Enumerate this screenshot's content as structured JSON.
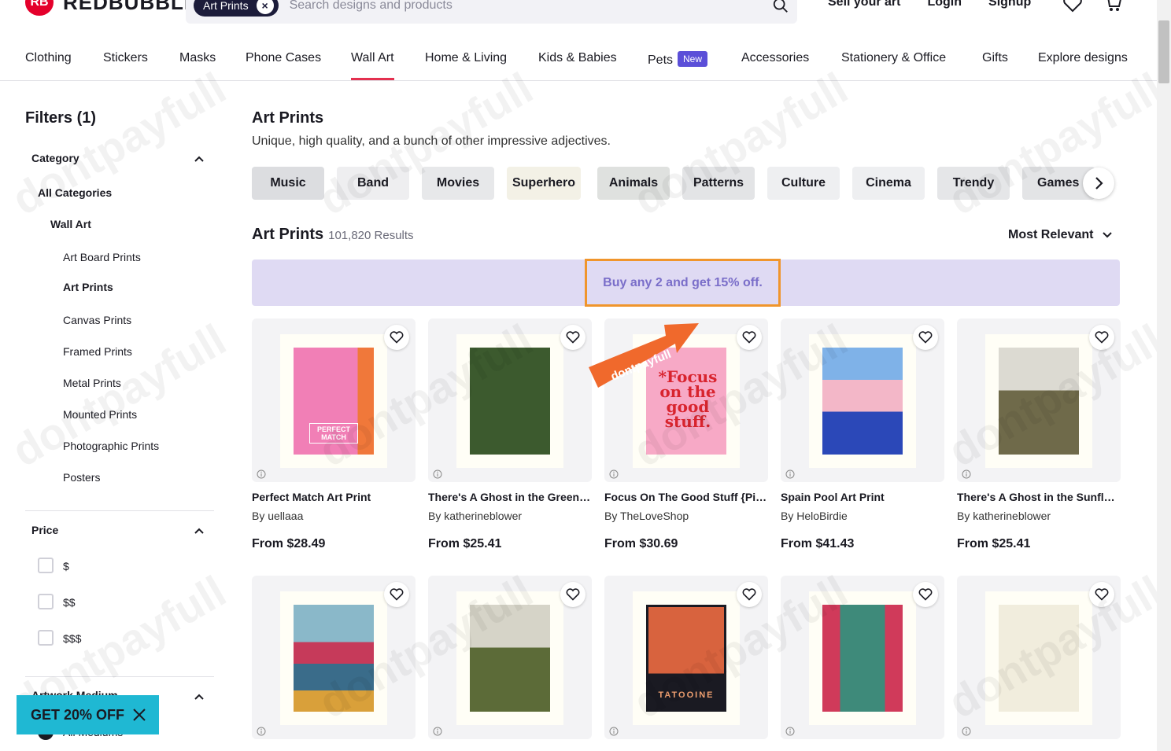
{
  "header": {
    "logo_text": "REDBUBBLE",
    "search_chip": "Art Prints",
    "search_placeholder": "Search designs and products",
    "links": [
      "Sell your art",
      "Login",
      "Signup"
    ]
  },
  "nav": {
    "items": [
      "Clothing",
      "Stickers",
      "Masks",
      "Phone Cases",
      "Wall Art",
      "Home & Living",
      "Kids & Babies",
      "Pets",
      "Accessories",
      "Stationery & Office",
      "Gifts",
      "Explore designs"
    ],
    "active": "Wall Art",
    "new_badge": "New"
  },
  "filters": {
    "title": "Filters (1)",
    "category_label": "Category",
    "all_categories": "All Categories",
    "wall_art": "Wall Art",
    "sub_items": [
      "Art Board Prints",
      "Art Prints",
      "Canvas Prints",
      "Framed Prints",
      "Metal Prints",
      "Mounted Prints",
      "Photographic Prints",
      "Posters"
    ],
    "selected": "Art Prints",
    "price_label": "Price",
    "price_options": [
      "$",
      "$$",
      "$$$"
    ],
    "medium_label": "Artwork Medium",
    "medium_first": "All Mediums"
  },
  "main": {
    "title": "Art Prints",
    "subtitle": "Unique, high quality, and a bunch of other impressive adjectives.",
    "tags": [
      "Music",
      "Band",
      "Movies",
      "Superhero",
      "Animals",
      "Patterns",
      "Culture",
      "Cinema",
      "Trendy",
      "Games"
    ],
    "tag_colors": [
      "#dcdde0",
      "#eeeef0",
      "#e7e8ea",
      "#f3f1e6",
      "#dfe1df",
      "#e3e4e6",
      "#eeeff1",
      "#eeeff1",
      "#e5e6e8",
      "#e3e4e6"
    ],
    "results_title": "Art Prints",
    "results_count": "101,820 Results",
    "sort_label": "Most Relevant",
    "promo": "Buy any 2 and get 15% off."
  },
  "products": [
    {
      "title": "Perfect Match Art Print",
      "artist": "By uellaaa",
      "price": "From $28.49",
      "art": "#f17fb6"
    },
    {
      "title": "There's A Ghost in the Greenhouse",
      "artist": "By katherineblower",
      "price": "From $25.41",
      "art": "#3c5a2e"
    },
    {
      "title": "Focus On The Good Stuff {Pink}",
      "artist": "By TheLoveShop",
      "price": "From $30.69",
      "art": "#f7a9c6"
    },
    {
      "title": "Spain Pool Art Print",
      "artist": "By HeloBirdie",
      "price": "From $41.43",
      "art": "#3a63c9"
    },
    {
      "title": "There's A Ghost in the Sunflower Field",
      "artist": "By katherineblower",
      "price": "From $25.41",
      "art": "#6f6a4a"
    },
    {
      "title": "",
      "artist": "",
      "price": "",
      "art": "#3a6c8a"
    },
    {
      "title": "",
      "artist": "",
      "price": "",
      "art": "#5c6b38"
    },
    {
      "title": "",
      "artist": "",
      "price": "",
      "art": "#d8633e"
    },
    {
      "title": "",
      "artist": "",
      "price": "",
      "art": "#3e8a7a"
    },
    {
      "title": "",
      "artist": "",
      "price": "",
      "art": "#f1eddd"
    }
  ],
  "art_text": {
    "focus": "*Focus on the good stuff.",
    "tatooine": "TATOOINE",
    "matchbox": "PERFECT MATCH"
  },
  "overlays": {
    "ribbon": "dontpayfull",
    "watermark": "dontpayfull",
    "coupon": "GET 20% OFF"
  }
}
